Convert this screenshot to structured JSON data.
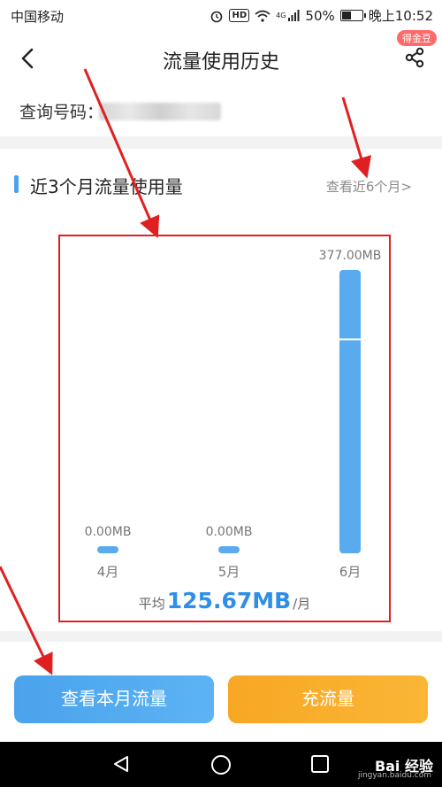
{
  "status_bar": {
    "carrier": "中国移动",
    "hd": "HD",
    "network": "4G",
    "battery": "50%",
    "battery_level": 0.5,
    "time": "晚上10:52"
  },
  "header": {
    "title": "流量使用历史",
    "badge": "得金豆"
  },
  "query": {
    "label": "查询号码："
  },
  "section": {
    "title": "近3个月流量使用量",
    "link": "查看近6个月>"
  },
  "chart_data": {
    "type": "bar",
    "categories": [
      "4月",
      "5月",
      "6月"
    ],
    "values": [
      0.0,
      0.0,
      377.0
    ],
    "value_labels": [
      "0.00MB",
      "0.00MB",
      "377.00MB"
    ],
    "ylim": [
      0,
      377
    ],
    "bar_color": "#5aaaf0"
  },
  "average": {
    "prefix": "平均",
    "value": "125.67MB",
    "suffix": "/月"
  },
  "buttons": {
    "view_label": "查看本月流量",
    "recharge_label": "充流量"
  },
  "watermark": {
    "brand": "Bai 经验",
    "url": "jingyan.baidu.com"
  },
  "colors": {
    "accent": "#4aa3ec",
    "primary_button": "#4aa3ec",
    "secondary_button": "#f7a723",
    "annotation": "#e02020"
  }
}
